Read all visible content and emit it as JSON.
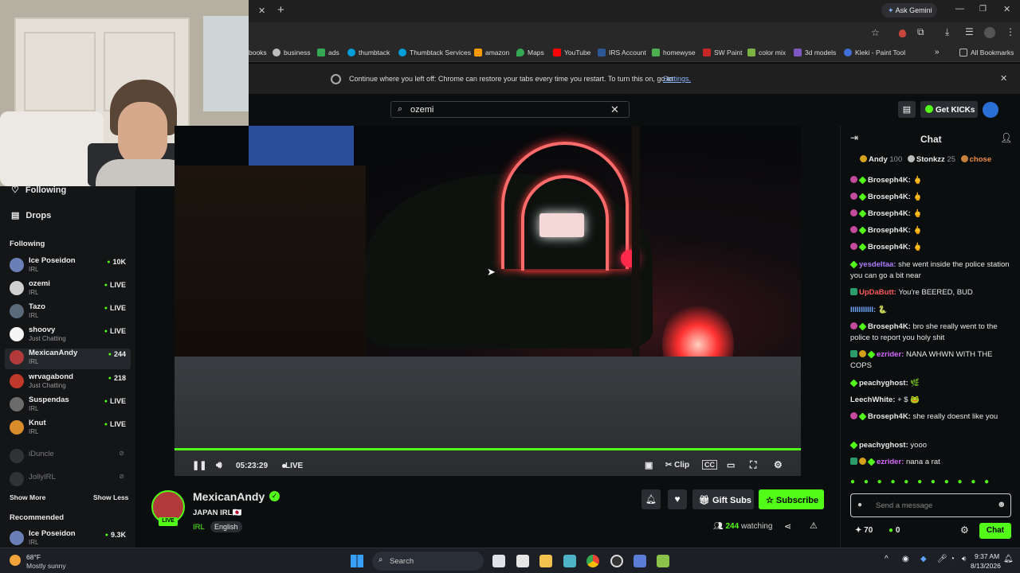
{
  "browser": {
    "new_tab": "+",
    "ask_gemini": "Ask Gemini",
    "bookmarks": [
      {
        "label": "books",
        "color": "#9aa0a6"
      },
      {
        "label": "business",
        "color": "#bdbdbd"
      },
      {
        "label": "ads",
        "color": "#34a853"
      },
      {
        "label": "thumbtack",
        "color": "#009fd9"
      },
      {
        "label": "Thumbtack Services",
        "color": "#009fd9"
      },
      {
        "label": "amazon",
        "color": "#ff9900"
      },
      {
        "label": "Maps",
        "color": "#34a853"
      },
      {
        "label": "YouTube",
        "color": "#ff0000"
      },
      {
        "label": "IRS Account",
        "color": "#2b5797"
      },
      {
        "label": "homewyse",
        "color": "#4caf50"
      },
      {
        "label": "SW Paint",
        "color": "#c62828"
      },
      {
        "label": "color mix",
        "color": "#7cb342"
      },
      {
        "label": "3d models",
        "color": "#7e57c2"
      },
      {
        "label": "Kleki - Paint Tool",
        "color": "#3f6fd8"
      }
    ],
    "all_bookmarks": "All Bookmarks",
    "restore_text": "Continue where you left off: Chrome can restore your tabs every time you restart. To turn this on, go to",
    "restore_link": "Settings."
  },
  "kick": {
    "search_value": "ozemi",
    "get_kicks": "Get KICKs"
  },
  "sidebar": {
    "nav_following": "Following",
    "nav_drops": "Drops",
    "following_heading": "Following",
    "channels": [
      {
        "name": "Ice Poseidon",
        "category": "IRL",
        "count": "10K",
        "avatar_color": "#6a7fb5"
      },
      {
        "name": "ozemi",
        "category": "IRL",
        "count": "LIVE",
        "avatar_color": "#cfcfcf"
      },
      {
        "name": "Tazo",
        "category": "IRL",
        "count": "LIVE",
        "avatar_color": "#5b6a7a"
      },
      {
        "name": "shoovy",
        "category": "Just Chatting",
        "count": "LIVE",
        "avatar_color": "#f5f5f5"
      },
      {
        "name": "MexicanAndy",
        "category": "IRL",
        "count": "244",
        "avatar_color": "#b23a3a"
      },
      {
        "name": "wrvagabond",
        "category": "Just Chatting",
        "count": "218",
        "avatar_color": "#c0392b"
      },
      {
        "name": "Suspendas",
        "category": "IRL",
        "count": "LIVE",
        "avatar_color": "#6b6b6b"
      },
      {
        "name": "Knut",
        "category": "IRL",
        "count": "LIVE",
        "avatar_color": "#d88c2a"
      }
    ],
    "offline": [
      "iDuncle",
      "JollyIRL"
    ],
    "show_more": "Show More",
    "show_less": "Show Less",
    "recommended_heading": "Recommended",
    "recommended": [
      {
        "name": "Ice Poseidon",
        "category": "IRL",
        "count": "9.3K",
        "avatar_color": "#6a7fb5"
      }
    ]
  },
  "player": {
    "time": "05:23:29",
    "live": "LIVE",
    "clip": "Clip",
    "progress": 1.0
  },
  "stream": {
    "streamer": "MexicanAndy",
    "title": "JAPAN IRL🇯🇵",
    "category": "IRL",
    "language": "English",
    "live_badge": "LIVE",
    "gift_subs": "Gift Subs",
    "subscribe": "Subscribe",
    "viewers": "244",
    "watching": "watching"
  },
  "chat": {
    "title": "Chat",
    "leaderboard": [
      {
        "rank": "1",
        "name": "Andy",
        "points": "100"
      },
      {
        "rank": "2",
        "name": "Stonkzz",
        "points": "25"
      },
      {
        "rank": "3",
        "name": "chose",
        "points": ""
      }
    ],
    "messages": [
      {
        "user": "Broseph4K:",
        "text": "🖕",
        "color": "#ffffff"
      },
      {
        "user": "Broseph4K:",
        "text": "🖕",
        "color": "#ffffff"
      },
      {
        "user": "Broseph4K:",
        "text": "🖕",
        "color": "#ffffff"
      },
      {
        "user": "Broseph4K:",
        "text": "🖕",
        "color": "#ffffff"
      },
      {
        "user": "Broseph4K:",
        "text": "🖕",
        "color": "#ffffff"
      },
      {
        "user": "yesdeltaa:",
        "text": "she went inside the police station you can go a bit near",
        "color": "#b07cff"
      },
      {
        "user": "UpDaButt:",
        "text": "You're BEERED, BUD",
        "color": "#ff5a5a"
      },
      {
        "user": "IIIIIIIIIII:",
        "text": "🐍",
        "color": "#6fa8ff"
      },
      {
        "user": "Broseph4K:",
        "text": "bro she really went to the police to report you holy shit",
        "color": "#ffffff"
      },
      {
        "user": "ezrider:",
        "text": "NANA WHWN WITH THE COPS",
        "color": "#d86bff"
      },
      {
        "user": "peachyghost:",
        "text": "🌿",
        "color": "#ffffff"
      },
      {
        "user": "LeechWhite:",
        "text": "+ $ 🐸",
        "color": "#ffffff"
      },
      {
        "user": "Broseph4K:",
        "text": "she really doesnt like you",
        "color": "#ffffff"
      },
      {
        "user": "peachyghost:",
        "text": "yooo",
        "color": "#ffffff"
      },
      {
        "user": "ezrider:",
        "text": "nana a rat",
        "color": "#d86bff"
      }
    ],
    "input_placeholder": "Send a message",
    "points": "70",
    "kicks": "0",
    "send": "Chat"
  },
  "taskbar": {
    "weather_temp": "68°F",
    "weather_text": "Mostly sunny",
    "search": "Search",
    "time": "9:37 AM",
    "date": "8/13/2026"
  }
}
